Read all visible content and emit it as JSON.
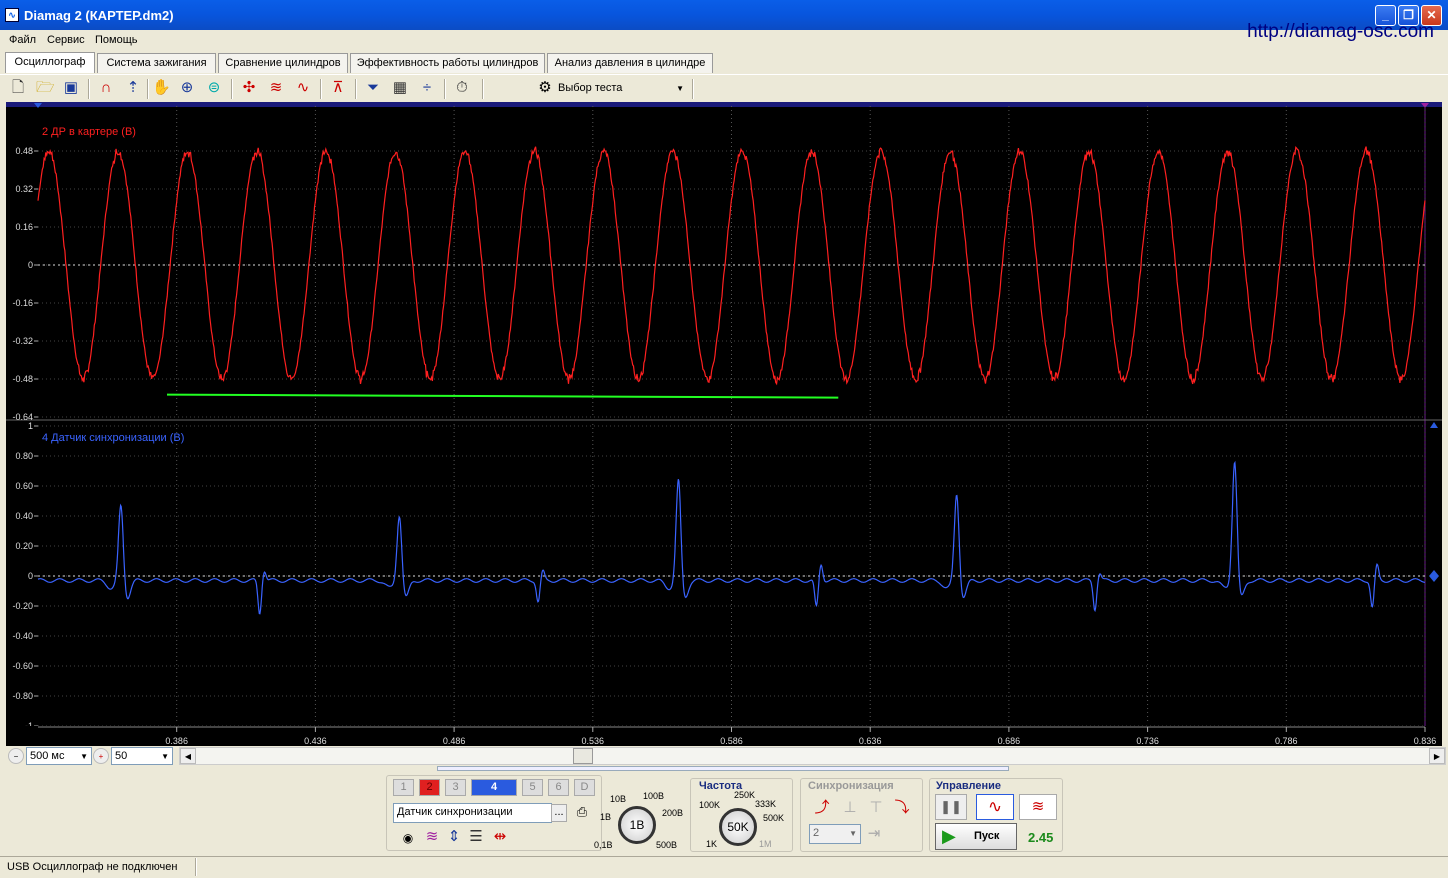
{
  "window": {
    "title": "Diamag 2 (КАРТЕР.dm2)",
    "url": "http://diamag-osc.com",
    "minimize": "_",
    "restore": "❐",
    "close": "✕"
  },
  "menu": [
    "Файл",
    "Сервис",
    "Помощь"
  ],
  "tabs": [
    {
      "label": "Осциллограф",
      "active": true
    },
    {
      "label": "Система зажигания"
    },
    {
      "label": "Сравнение цилиндров"
    },
    {
      "label": "Эффективность работы цилиндров"
    },
    {
      "label": "Анализ давления в цилиндре"
    }
  ],
  "toolbar": {
    "icons": [
      "new-file-icon",
      "open-folder-icon",
      "save-icon",
      "channel-curve-icon",
      "cursor-measure-icon",
      "hand-pan-icon",
      "zoom-icon",
      "probe-icon",
      "crosshair-icon",
      "wave-compare-icon",
      "wave-overlay-icon",
      "auto-trigger-icon",
      "filter-icon",
      "grid-icon",
      "divider-icon",
      "auto-settings-icon"
    ],
    "test_select": "Выбор теста"
  },
  "colors": {
    "channel2": "#ff2020",
    "channel4": "#3a63ff",
    "marker": "#22ff22",
    "accent": "#0a5ee8"
  },
  "chart_data": [
    {
      "type": "line",
      "label": "2 ДР в картере (В)",
      "y_ticks": [
        "0.48",
        "0.32",
        "0.16",
        "0",
        "-0.16",
        "-0.32",
        "-0.48",
        "-0.64"
      ],
      "ylim": [
        -0.64,
        0.59
      ],
      "x_ticks": [
        "0.386",
        "0.436",
        "0.486",
        "0.536",
        "0.586",
        "0.636",
        "0.686",
        "0.736",
        "0.786",
        "0.836"
      ],
      "xlim": [
        0.336,
        0.836
      ],
      "series": [
        {
          "waveform": "sine",
          "amplitude": 0.48,
          "cycles": 20,
          "color": "#ff2020"
        }
      ],
      "marker_line": {
        "x_start": 0.3825,
        "x_end": 0.6245,
        "y": -0.55
      }
    },
    {
      "type": "line",
      "label": "4 Датчик синхронизации (В)",
      "y_ticks": [
        "1",
        "0.80",
        "0.60",
        "0.40",
        "0.20",
        "0",
        "-0.20",
        "-0.40",
        "-0.60",
        "-0.80",
        "-1"
      ],
      "ylim": [
        -1,
        1
      ],
      "series": [
        {
          "color": "#3a63ff",
          "peaks": [
            {
              "x": 0.3659,
              "y": 0.52
            },
            {
              "x": 0.4663,
              "y": 0.46
            },
            {
              "x": 0.5669,
              "y": 0.69
            },
            {
              "x": 0.6672,
              "y": 0.6
            },
            {
              "x": 0.7674,
              "y": 0.82
            }
          ],
          "small_pulses": [
            {
              "x": 0.4164,
              "y": 0.07,
              "dip": -0.22
            },
            {
              "x": 0.5168,
              "y": 0.06,
              "dip": -0.14
            },
            {
              "x": 0.6171,
              "y": 0.11,
              "dip": -0.18
            },
            {
              "x": 0.7175,
              "y": 0.05,
              "dip": -0.19
            },
            {
              "x": 0.8175,
              "y": 0.1,
              "dip": -0.18
            }
          ]
        }
      ]
    }
  ],
  "bottom_bar": {
    "timebase": "500 мс",
    "zoom": "50"
  },
  "channels": {
    "buttons": [
      "1",
      "2",
      "3",
      "4",
      "5",
      "6",
      "D"
    ],
    "active": "4",
    "selected_name": "Датчик синхронизации",
    "more": "..."
  },
  "voltage_knob": {
    "labels": [
      "10В",
      "100В",
      "200В",
      "500В",
      "0,1В",
      "1В"
    ],
    "value": "1В"
  },
  "frequency": {
    "title": "Частота",
    "labels": [
      "250K",
      "333K",
      "100K",
      "500K",
      "1K",
      "1M"
    ],
    "value": "50K"
  },
  "sync": {
    "title": "Синхронизация",
    "channel": "2"
  },
  "control": {
    "title": "Управление",
    "start": "Пуск",
    "value": "2.45"
  },
  "status": {
    "text": "USB Осциллограф не подключен"
  }
}
